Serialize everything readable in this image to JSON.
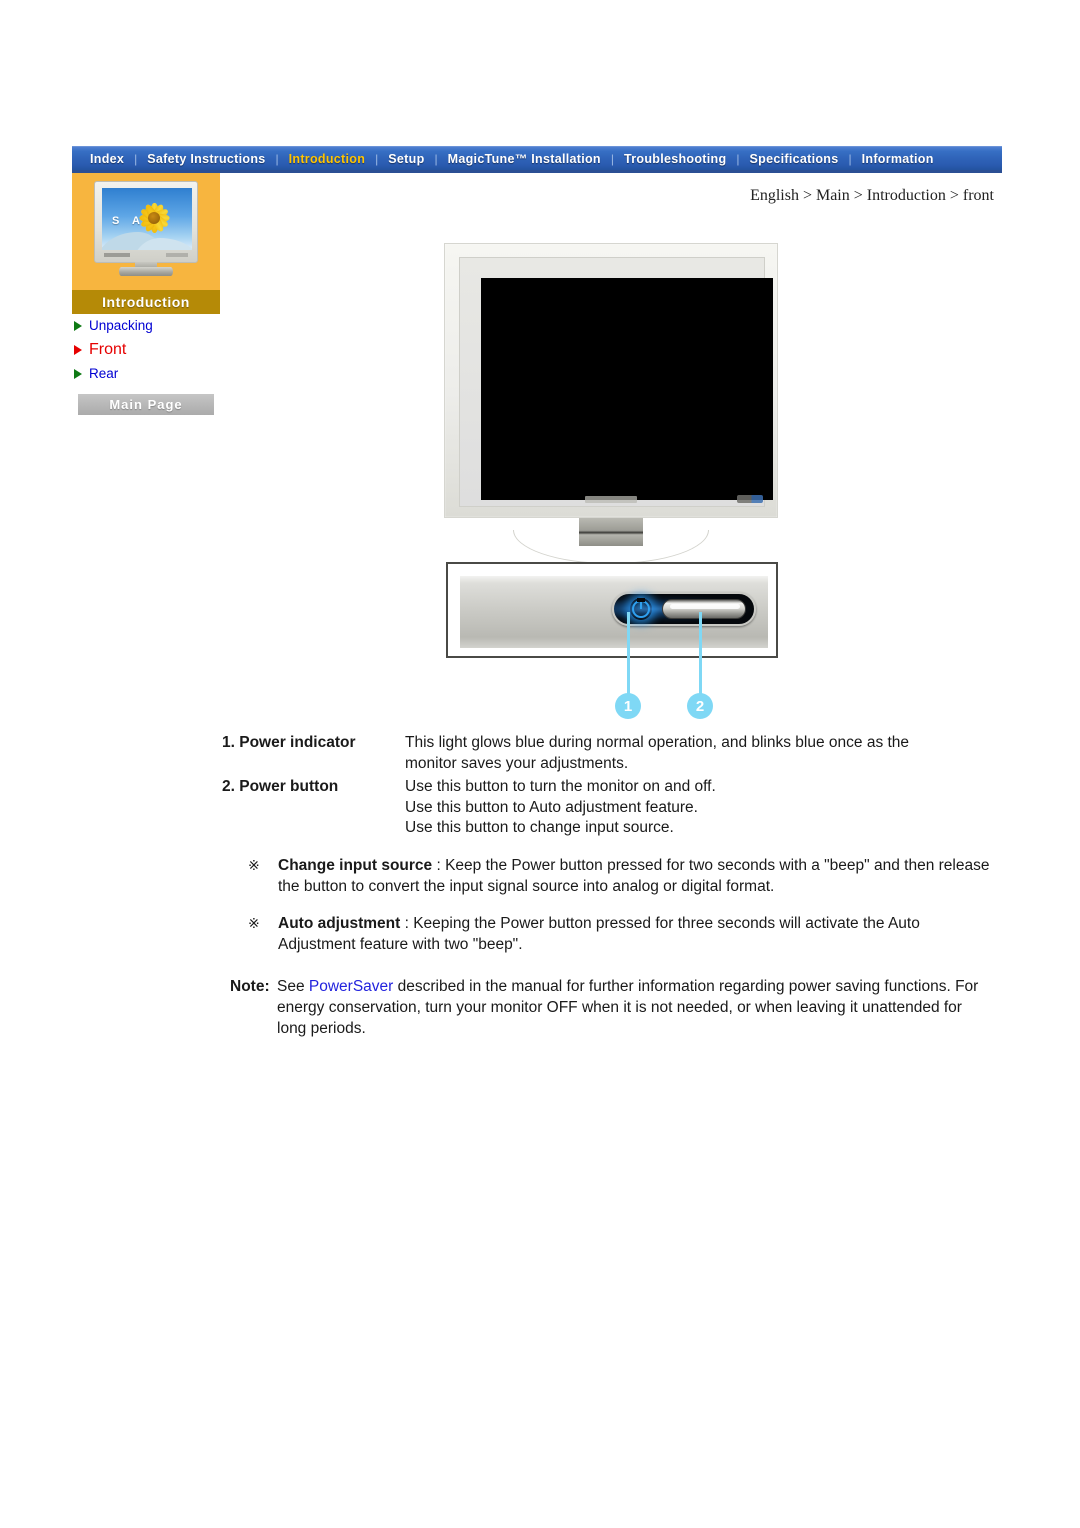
{
  "nav": {
    "items": [
      {
        "label": "Index",
        "active": false
      },
      {
        "label": "Safety Instructions",
        "active": false
      },
      {
        "label": "Introduction",
        "active": true
      },
      {
        "label": "Setup",
        "active": false
      },
      {
        "label": "MagicTune™ Installation",
        "active": false
      },
      {
        "label": "Troubleshooting",
        "active": false
      },
      {
        "label": "Specifications",
        "active": false
      },
      {
        "label": "Information",
        "active": false
      }
    ],
    "separator": "|",
    "active_color": "#ffc400",
    "bar_color": "#2f63b8"
  },
  "breadcrumb": {
    "text": "English > Main > Introduction > front"
  },
  "sidebar": {
    "section_label": "Introduction",
    "thumbnail_text": "S A M",
    "links": [
      {
        "label": "Unpacking",
        "current": false
      },
      {
        "label": "Front",
        "current": true
      },
      {
        "label": "Rear",
        "current": false
      }
    ],
    "main_page_button": "Main Page",
    "link_color": "#0000d2",
    "current_color": "#e60000",
    "panel_color": "#f7b53f",
    "label_bar_color": "#b58a07"
  },
  "figure": {
    "callouts": [
      {
        "number": "1"
      },
      {
        "number": "2"
      }
    ],
    "callout_color": "#7fd8f5"
  },
  "content": {
    "definitions": [
      {
        "term": "1. Power indicator",
        "lines": [
          "This light glows blue during normal operation, and blinks blue once as the",
          "monitor saves your adjustments."
        ]
      },
      {
        "term": "2. Power button",
        "lines": [
          "Use this button to turn the monitor on and off.",
          "Use this button to Auto adjustment feature.",
          "Use this button to change input source."
        ]
      }
    ],
    "notes": [
      {
        "mark": "※",
        "bold": "Change input source",
        "rest": " : Keep the Power button pressed for two seconds with a \"beep\" and then release the button to convert the input signal source into analog or digital format."
      },
      {
        "mark": "※",
        "bold": "Auto adjustment",
        "rest": " : Keeping the Power button pressed for three seconds will activate the Auto Adjustment feature with two \"beep\"."
      }
    ],
    "note": {
      "label": "Note:",
      "before_link": " See ",
      "link": "PowerSaver",
      "after_link": " described in the manual for further information regarding power saving functions. For energy conservation, turn your monitor OFF when it is not needed, or when leaving it unattended for long periods."
    }
  }
}
